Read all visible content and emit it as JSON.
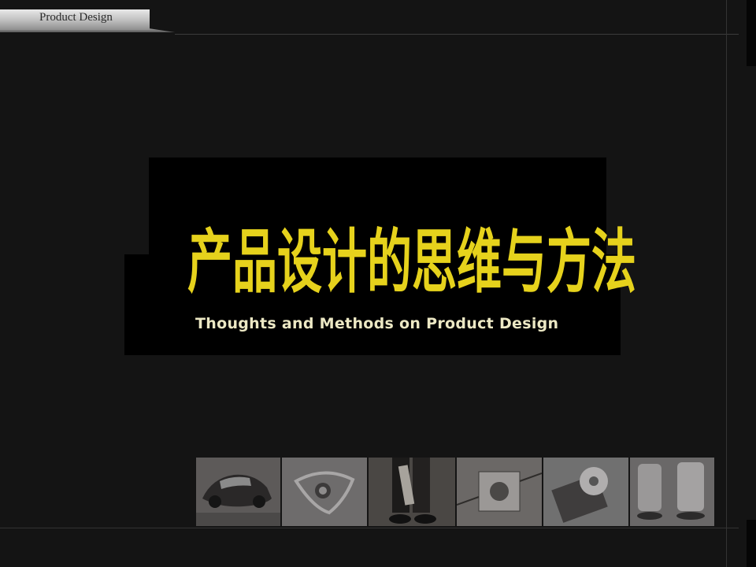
{
  "header": {
    "title": "Product Design"
  },
  "slide": {
    "title_cn": "产品设计的思维与方法",
    "title_en": "Thoughts and Methods on Product Design"
  },
  "thumbnails": [
    {
      "name": "car-photo",
      "tone": "#5d5a59"
    },
    {
      "name": "abstract-object-photo",
      "tone": "#6e6c6c"
    },
    {
      "name": "person-legs-photo",
      "tone": "#4a4744"
    },
    {
      "name": "circuit-device-photo",
      "tone": "#6b6866"
    },
    {
      "name": "disc-device-photo",
      "tone": "#707070"
    },
    {
      "name": "appliance-photo",
      "tone": "#6a6868"
    }
  ]
}
